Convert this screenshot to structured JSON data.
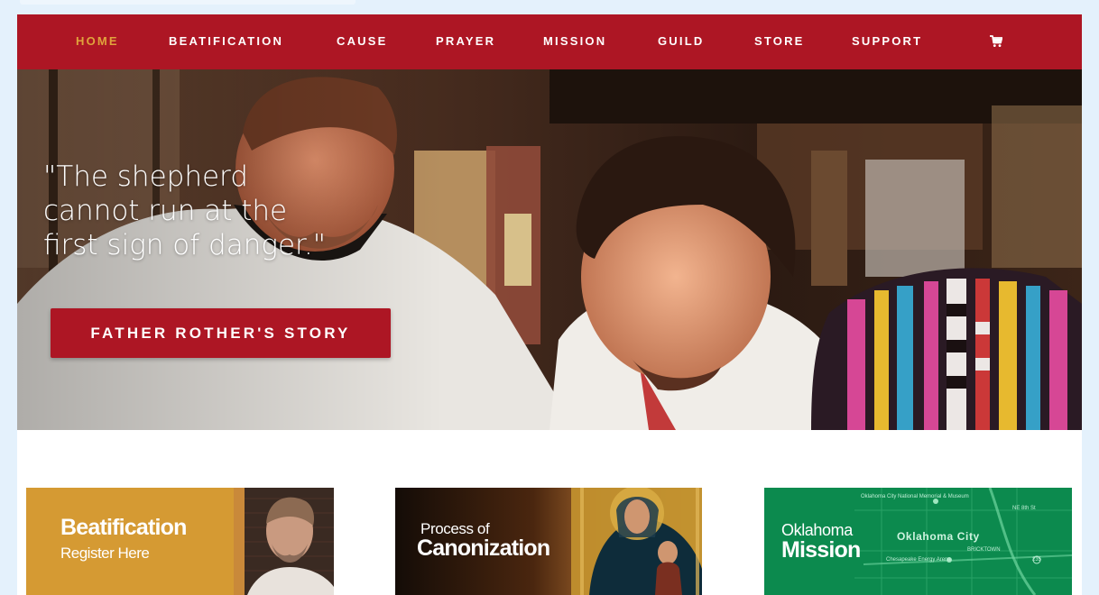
{
  "nav": {
    "items": [
      {
        "label": "HOME",
        "active": true
      },
      {
        "label": "BEATIFICATION"
      },
      {
        "label": "CAUSE"
      },
      {
        "label": "PRAYER"
      },
      {
        "label": "MISSION"
      },
      {
        "label": "GUILD"
      },
      {
        "label": "STORE"
      },
      {
        "label": "SUPPORT"
      }
    ],
    "cart_icon": "shopping-cart-icon"
  },
  "hero": {
    "quote_lines": [
      "\"The shepherd",
      "cannot run at the",
      "first sign of danger.\""
    ],
    "cta_label": "FATHER ROTHER'S STORY"
  },
  "cards": [
    {
      "title": "Beatification",
      "subtitle": "Register Here"
    },
    {
      "small": "Process of",
      "title": "Canonization"
    },
    {
      "small": "Oklahoma",
      "title": "Mission",
      "map_labels": {
        "memorial": "Oklahoma City National Memorial & Museum",
        "city": "Oklahoma City",
        "bricktown": "BRICKTOWN",
        "arena": "Chesapeake Energy Arena",
        "highway": "235",
        "street": "NE 8th St"
      }
    }
  ],
  "colors": {
    "brand_red": "#ad1624",
    "nav_active": "#e0a33c",
    "page_bg": "#e4f1fc",
    "card_gold": "#d59a33",
    "card_green": "#0c8a4e"
  }
}
